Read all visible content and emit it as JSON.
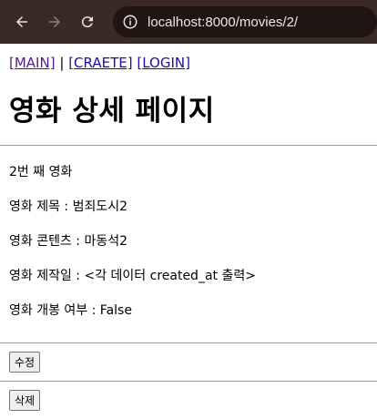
{
  "browser": {
    "url": "localhost:8000/movies/2/"
  },
  "nav": {
    "main": "[MAIN]",
    "separator": "|",
    "create": "[CRAETE]",
    "login": "[LOGIN]"
  },
  "page": {
    "title": "영화 상세 페이지",
    "movie_number": "2번 째 영화",
    "movie_title": "영화 제목 : 범죄도시2",
    "movie_content": "영화 콘텐츠 : 마동석2",
    "movie_created": "영화 제작일 : <각 데이터 created_at 출력>",
    "movie_released": "영화 개봉 여부 : False"
  },
  "actions": {
    "edit_label": "수정",
    "delete_label": "삭제"
  },
  "icons": {
    "back": "arrow-left",
    "forward": "arrow-right",
    "reload": "refresh",
    "info": "info-circle"
  }
}
